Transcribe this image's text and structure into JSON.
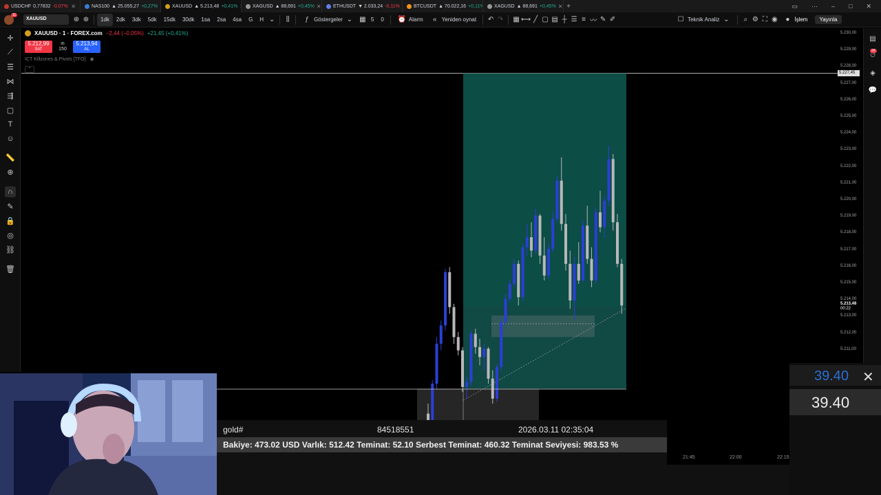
{
  "tabs": [
    {
      "symbol": "USDCHF",
      "price": "0,77832",
      "change": "-0,07%",
      "dot": "#c0392b",
      "up": false
    },
    {
      "symbol": "NAS100",
      "price": "▲ 25.055,27",
      "change": "+0,27%",
      "dot": "#3a7bd5",
      "up": true
    },
    {
      "symbol": "XAUUSD",
      "price": "▲ 5.213,48",
      "change": "+0,41%",
      "dot": "#d4a017",
      "up": true,
      "active": true
    },
    {
      "symbol": "XAGUSD",
      "price": "▲ 88,691",
      "change": "+0,45%",
      "dot": "#999999",
      "up": true
    },
    {
      "symbol": "ETHUSDT",
      "price": "▼ 2.033,24",
      "change": "-0,11%",
      "dot": "#627eea",
      "up": false
    },
    {
      "symbol": "BTCUSDT",
      "price": "▲ 70.022,16",
      "change": "+0,11%",
      "dot": "#f7931a",
      "up": true
    },
    {
      "symbol": "XAGUSD",
      "price": "▲ 88,691",
      "change": "+0,45%",
      "dot": "#999999",
      "up": true
    }
  ],
  "toolbar": {
    "notif_count": "11",
    "symbol": "XAUUSD",
    "intervals": [
      "1dk",
      "2dk",
      "3dk",
      "5dk",
      "15dk",
      "30dk",
      "1sa",
      "2sa",
      "4sa",
      "G",
      "H"
    ],
    "selected_interval": "1dk",
    "indicators_label": "Göstergeler",
    "layout_count_a": "5",
    "layout_count_b": "0",
    "alarm_label": "Alarm",
    "replay_label": "Yeniden oynat",
    "technical_label": "Teknik Analiz",
    "trade_label": "İşlem",
    "publish_label": "Yayınla"
  },
  "legend": {
    "title": "XAUUSD · 1 · FOREX.com",
    "change": "−2,44 (−0,05%)",
    "change2": "+21,45 (+0,41%)",
    "sell_price": "5.212,99",
    "sell_label": "SAT",
    "spread_top": "95",
    "spread": "150",
    "buy_price": "5.213,94",
    "buy_label": "AL",
    "indicator": "ICT Killzones & Pivots [TFO]"
  },
  "price_axis": {
    "ticks": [
      "5.230,00",
      "5.229,00",
      "5.228,00",
      "5.227,00",
      "5.226,00",
      "5.225,00",
      "5.224,00",
      "5.223,00",
      "5.222,00",
      "5.221,00",
      "5.220,00",
      "5.219,00",
      "5.218,00",
      "5.217,00",
      "5.216,00",
      "5.215,00",
      "5.214,00",
      "5.213,00",
      "5.212,00",
      "5.211,00",
      "5.210,00"
    ],
    "line_label": "5.227,45",
    "current_price": "5.213,48",
    "countdown": "00:22"
  },
  "time_axis": [
    "21:45",
    "22:00",
    "22:15"
  ],
  "right_rail": {
    "badge": "26"
  },
  "mt_panel": {
    "symbol": "gold#",
    "ticket": "84518551",
    "datetime": "2026.03.11 02:35:04",
    "summary": "Bakiye: 473.02 USD  Varlık: 512.42  Teminat: 52.10  Serbest Teminat: 460.32  Teminat Seviyesi: 983.53 %"
  },
  "lot_panel": {
    "top_value": "39.40",
    "box_value": "39.40"
  },
  "colors": {
    "bull": "#2b3fd6",
    "bear": "#b8b8b8",
    "profit_zone": "#0e5a52",
    "loss_zone": "#13514b",
    "sell": "#f23645",
    "buy": "#2962ff"
  }
}
